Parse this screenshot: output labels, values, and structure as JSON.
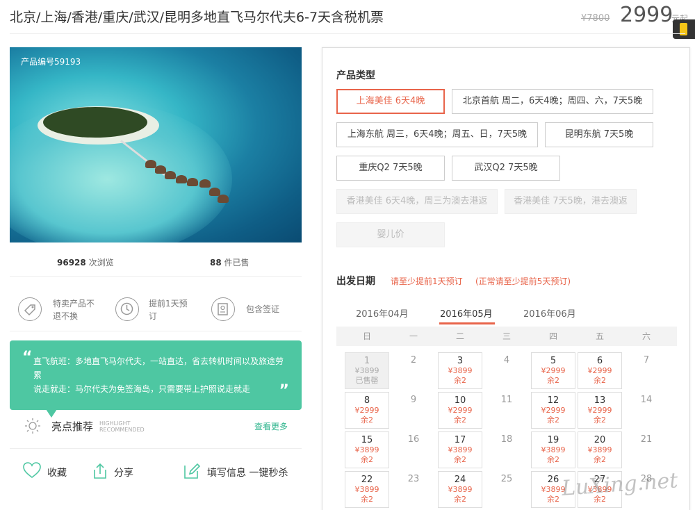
{
  "header": {
    "title": "北京/上海/香港/重庆/武汉/昆明多地直飞马尔代夫6-7天含税机票",
    "old_price": "¥7800",
    "price": "2999",
    "price_suffix": "元起"
  },
  "product": {
    "id_label": "产品编号59193",
    "views_count": "96928",
    "views_label": " 次浏览",
    "sold_count": "88",
    "sold_label": " 件已售"
  },
  "features": [
    {
      "icon": "tag-icon",
      "text": "特卖产品不退不换"
    },
    {
      "icon": "clock-icon",
      "text": "提前1天预订"
    },
    {
      "icon": "passport-icon",
      "text": "包含签证"
    }
  ],
  "highlight_box": {
    "line1": "直飞航班：多地直飞马尔代夫，一站直达，省去转机时间以及旅途劳累",
    "line2": "说走就走：马尔代夫为免签海岛，只需要带上护照说走就走"
  },
  "highlights": {
    "title": "亮点推荐",
    "sub1": "HIGHLIGHT",
    "sub2": "RECOMMENDED",
    "more": "查看更多"
  },
  "actions": {
    "favorite": "收藏",
    "share": "分享",
    "fill_info": "填写信息 一键秒杀"
  },
  "product_types": {
    "title": "产品类型",
    "options": [
      {
        "label": "上海美佳 6天4晚",
        "state": "selected"
      },
      {
        "label": "北京首航 周二，6天4晚；周四、六，7天5晚",
        "state": "normal"
      },
      {
        "label": "上海东航 周三，6天4晚；周五、日，7天5晚",
        "state": "normal"
      },
      {
        "label": "昆明东航 7天5晚",
        "state": "normal"
      },
      {
        "label": "重庆Q2 7天5晚",
        "state": "normal"
      },
      {
        "label": "武汉Q2 7天5晚",
        "state": "normal"
      },
      {
        "label": "香港美佳 6天4晚，周三为澳去港返",
        "state": "disabled"
      },
      {
        "label": "香港美佳 7天5晚，港去澳返",
        "state": "disabled"
      },
      {
        "label": "婴儿价",
        "state": "disabled"
      }
    ]
  },
  "departure": {
    "title": "出发日期",
    "note1": "请至少提前1天预订",
    "note2": "(正常请至少提前5天预订)",
    "months": [
      "2016年04月",
      "2016年05月",
      "2016年06月"
    ],
    "weekdays": [
      "日",
      "一",
      "二",
      "三",
      "四",
      "五",
      "六"
    ],
    "days": [
      {
        "n": "1",
        "price": "¥3899",
        "stock": "已售罄",
        "state": "sold"
      },
      {
        "n": "2"
      },
      {
        "n": "3",
        "price": "¥3899",
        "stock": "余2",
        "state": "av"
      },
      {
        "n": "4"
      },
      {
        "n": "5",
        "price": "¥2999",
        "stock": "余2",
        "state": "av"
      },
      {
        "n": "6",
        "price": "¥2999",
        "stock": "余2",
        "state": "av"
      },
      {
        "n": "7"
      },
      {
        "n": "8",
        "price": "¥2999",
        "stock": "余2",
        "state": "av"
      },
      {
        "n": "9"
      },
      {
        "n": "10",
        "price": "¥2999",
        "stock": "余2",
        "state": "av"
      },
      {
        "n": "11"
      },
      {
        "n": "12",
        "price": "¥2999",
        "stock": "余2",
        "state": "av"
      },
      {
        "n": "13",
        "price": "¥2999",
        "stock": "余2",
        "state": "av"
      },
      {
        "n": "14"
      },
      {
        "n": "15",
        "price": "¥3899",
        "stock": "余2",
        "state": "av"
      },
      {
        "n": "16"
      },
      {
        "n": "17",
        "price": "¥3899",
        "stock": "余2",
        "state": "av"
      },
      {
        "n": "18"
      },
      {
        "n": "19",
        "price": "¥3899",
        "stock": "余2",
        "state": "av"
      },
      {
        "n": "20",
        "price": "¥3899",
        "stock": "余2",
        "state": "av"
      },
      {
        "n": "21"
      },
      {
        "n": "22",
        "price": "¥3899",
        "stock": "余2",
        "state": "av"
      },
      {
        "n": "23"
      },
      {
        "n": "24",
        "price": "¥3899",
        "stock": "余2",
        "state": "av"
      },
      {
        "n": "25"
      },
      {
        "n": "26",
        "price": "¥3899",
        "stock": "余2",
        "state": "av"
      },
      {
        "n": "27",
        "price": "¥3899",
        "stock": "余2",
        "state": "av"
      },
      {
        "n": "28"
      }
    ]
  },
  "watermark": "LuXing.net"
}
